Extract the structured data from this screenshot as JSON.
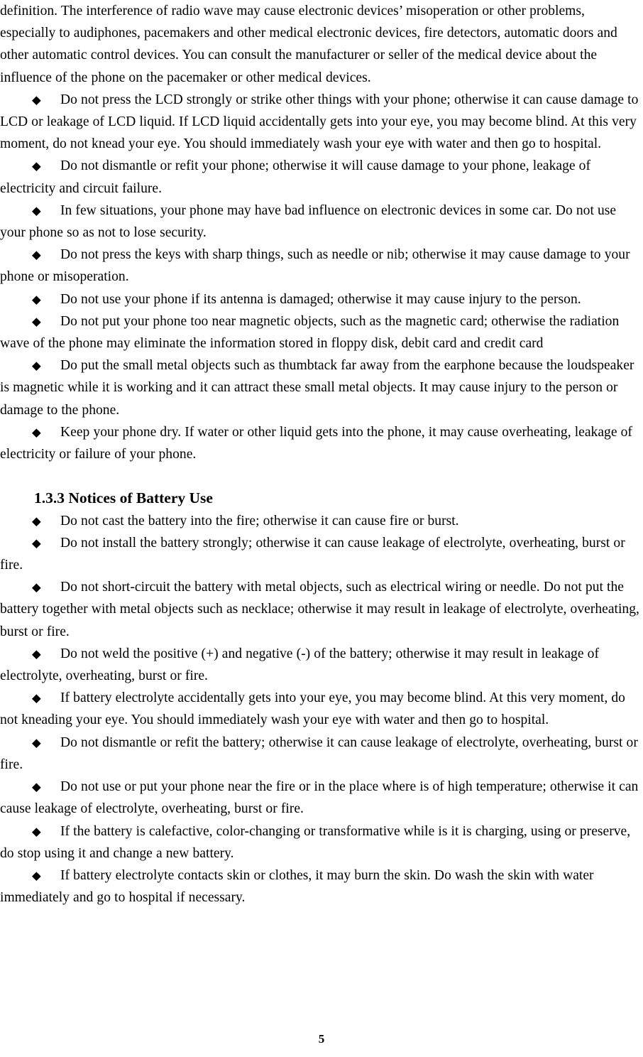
{
  "document": {
    "page_number": "5",
    "bullet_glyph": "◆",
    "text_color": "#000000",
    "background_color": "#ffffff"
  },
  "continued_paragraph": {
    "text": "definition. The interference of radio wave may cause electronic devices’ misoperation or other problems, especially to audiphones, pacemakers and other medical electronic devices, fire detectors, automatic doors and other automatic control devices. You can consult the manufacturer or seller of the medical device about the influence of the phone on the pacemaker or other medical devices."
  },
  "phone_notices": {
    "items": [
      "Do not press the LCD strongly or strike other things with your phone; otherwise it can cause damage to LCD or leakage of LCD liquid. If LCD liquid accidentally gets into your eye, you may become blind. At this very moment, do not knead your eye. You should immediately wash your eye with water and then go to hospital.",
      "Do not dismantle or refit your phone; otherwise it will cause damage to your phone, leakage of electricity and circuit failure.",
      "In few situations, your phone may have bad influence on electronic devices in some car. Do not use your phone so as not to lose security.",
      "Do not press the keys with sharp things, such as needle or nib; otherwise it may cause damage to your phone or misoperation.",
      "Do not use your phone if its antenna is damaged; otherwise it may cause injury to the person.",
      "Do not put your phone too near magnetic objects, such as the magnetic card; otherwise the radiation wave of the phone may eliminate the information stored in floppy disk, debit card and credit card",
      "Do put the small metal objects such as thumbtack far away from the earphone because the loudspeaker is magnetic while it is working and it can attract these small metal objects. It may cause injury to the person or damage to the phone.",
      "Keep your phone dry. If water or other liquid gets into the phone, it may cause overheating, leakage of electricity or failure of your phone."
    ]
  },
  "battery_section": {
    "heading": "1.3.3 Notices of Battery Use",
    "items": [
      "Do not cast the battery into the fire; otherwise it can cause fire or burst.",
      "Do not install the battery strongly; otherwise it can cause leakage of electrolyte, overheating, burst or fire.",
      "Do not short-circuit the battery with metal objects, such as electrical wiring or needle. Do not put the battery together with metal objects such as necklace; otherwise it may result in leakage of electrolyte, overheating, burst or fire.",
      "Do not weld the positive (+) and negative (-) of the battery; otherwise it may result in leakage of electrolyte, overheating, burst or fire.",
      "If battery electrolyte accidentally gets into your eye, you may become blind. At this very moment, do not kneading your eye. You should immediately wash your eye with water and then go to hospital.",
      "Do not dismantle or refit the battery; otherwise it can cause leakage of electrolyte, overheating, burst or fire.",
      "Do not use or put your phone near the fire or in the place where is of high temperature; otherwise it can cause leakage of electrolyte, overheating, burst or fire.",
      "If the battery is calefactive, color-changing or transformative while is it is charging, using or preserve, do stop using it and change a new battery.",
      "If battery electrolyte contacts skin or clothes, it may burn the skin. Do wash the skin with water immediately and go to hospital if necessary."
    ]
  }
}
